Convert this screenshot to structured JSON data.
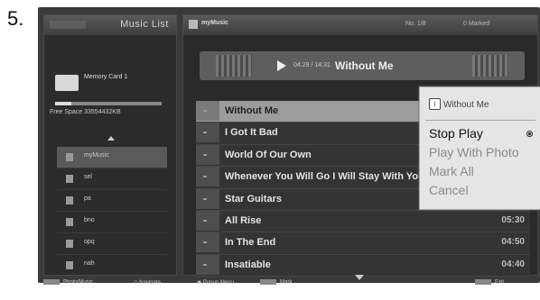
{
  "step": "5.",
  "left_panel": {
    "title": "Music List",
    "card_label": "Memory Card 1",
    "free_space": "Free Space 33554432KB",
    "folders": [
      "myMusic",
      "sel",
      "pa",
      "bno",
      "opq",
      "nah"
    ]
  },
  "right_panel": {
    "app_name": "myMusic",
    "page_info": "No. 1/8",
    "marked_info": "0 Marked",
    "now_playing": {
      "time": "04:29 / 14:31",
      "title": "Without Me"
    },
    "tracks": [
      {
        "title": "Without Me",
        "duration": ""
      },
      {
        "title": "I Got It Bad",
        "duration": ""
      },
      {
        "title": "World Of Our Own",
        "duration": ""
      },
      {
        "title": "Whenever You Will Go I Will Stay With You",
        "duration": ""
      },
      {
        "title": "Star Guitars",
        "duration": ""
      },
      {
        "title": "All Rise",
        "duration": "05:30"
      },
      {
        "title": "In The End",
        "duration": "04:50"
      },
      {
        "title": "Insatiable",
        "duration": "04:40"
      }
    ]
  },
  "bottom_bar": {
    "photo_music": "Photo/Music",
    "navigate": "Navigate",
    "popup_menu": "Popup Menu",
    "mark": "Mark",
    "exit": "Exit"
  },
  "popup": {
    "title": "Without Me",
    "items": [
      "Stop Play",
      "Play With Photo",
      "Mark All",
      "Cancel"
    ],
    "active_item": "Stop Play"
  }
}
